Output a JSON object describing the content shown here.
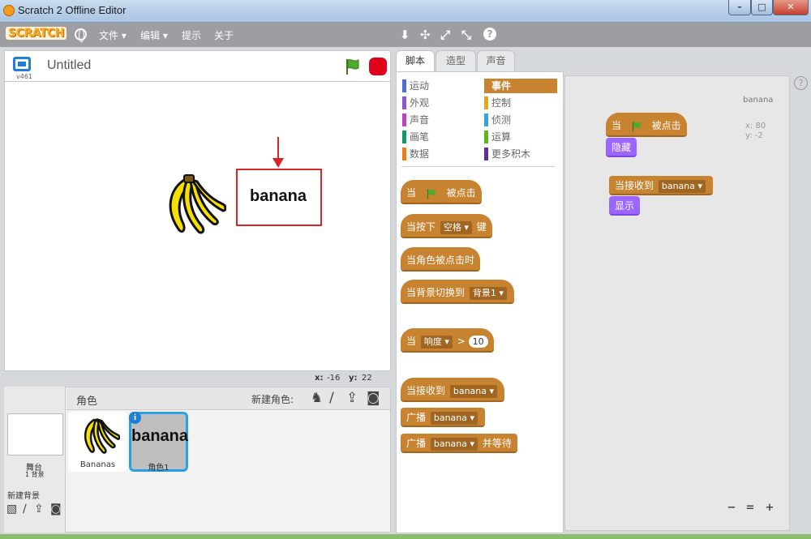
{
  "window": {
    "title": "Scratch 2 Offline Editor",
    "min": "–",
    "max": "□",
    "close": "✕"
  },
  "menu": {
    "logo": "SCRATCH",
    "file": "文件 ▾",
    "edit": "编辑 ▾",
    "tips": "提示",
    "about": "关于"
  },
  "toolbar": {
    "duplicate": "⬇",
    "delete": "✣",
    "grow": "⤢",
    "shrink": "⤡",
    "help": "?"
  },
  "stage": {
    "version": "v461",
    "project_title": "Untitled",
    "sprite_text": "banana",
    "x_label": "x:",
    "x_value": "-16",
    "y_label": "y:",
    "y_value": "22"
  },
  "sprites": {
    "header_label": "角色",
    "new_sprite_label": "新建角色:",
    "stage_label": "舞台",
    "stage_backdrops": "1 背景",
    "new_backdrop_label": "新建背景",
    "items": [
      {
        "name": "Bananas"
      },
      {
        "name": "角色1",
        "text": "banana",
        "info": "i"
      }
    ]
  },
  "tabs": [
    {
      "label": "脚本"
    },
    {
      "label": "造型"
    },
    {
      "label": "声音"
    }
  ],
  "categories": {
    "motion": "运动",
    "looks": "外观",
    "sound": "声音",
    "pen": "画笔",
    "data": "数据",
    "events": "事件",
    "control": "控制",
    "sensing": "侦测",
    "operators": "运算",
    "more": "更多积木"
  },
  "category_colors": {
    "motion": "#4a6cd4",
    "looks": "#8a55d7",
    "sound": "#bb42c3",
    "pen": "#0e9a6c",
    "data": "#ee7d16",
    "events": "#c88330",
    "control": "#e1a91a",
    "sensing": "#2ca5e2",
    "operators": "#5cb712",
    "more": "#632d99"
  },
  "palette_blocks": {
    "flag_when": "当",
    "flag_clicked": "被点击",
    "key_pressed_pre": "当按下",
    "key_value": "空格",
    "key_pressed_post": "键",
    "sprite_clicked": "当角色被点击时",
    "backdrop_switch": "当背景切换到",
    "backdrop_value": "背景1",
    "sensor_when": "当",
    "sensor_value": "响度",
    "sensor_gt": ">",
    "sensor_num": "10",
    "receive": "当接收到",
    "receive_value": "banana",
    "broadcast": "广播",
    "broadcast_value": "banana",
    "broadcast_wait": "广播",
    "broadcast_wait_value": "banana",
    "broadcast_wait_post": "并等待"
  },
  "script": {
    "sprite_name": "banana",
    "x": "x: 80",
    "y": "y: -2",
    "flag_when": "当",
    "flag_clicked": "被点击",
    "hide": "隐藏",
    "receive": "当接收到",
    "receive_value": "banana",
    "show": "显示"
  },
  "zoom": {
    "out": "−",
    "reset": "=",
    "in": "+"
  },
  "help": "?"
}
